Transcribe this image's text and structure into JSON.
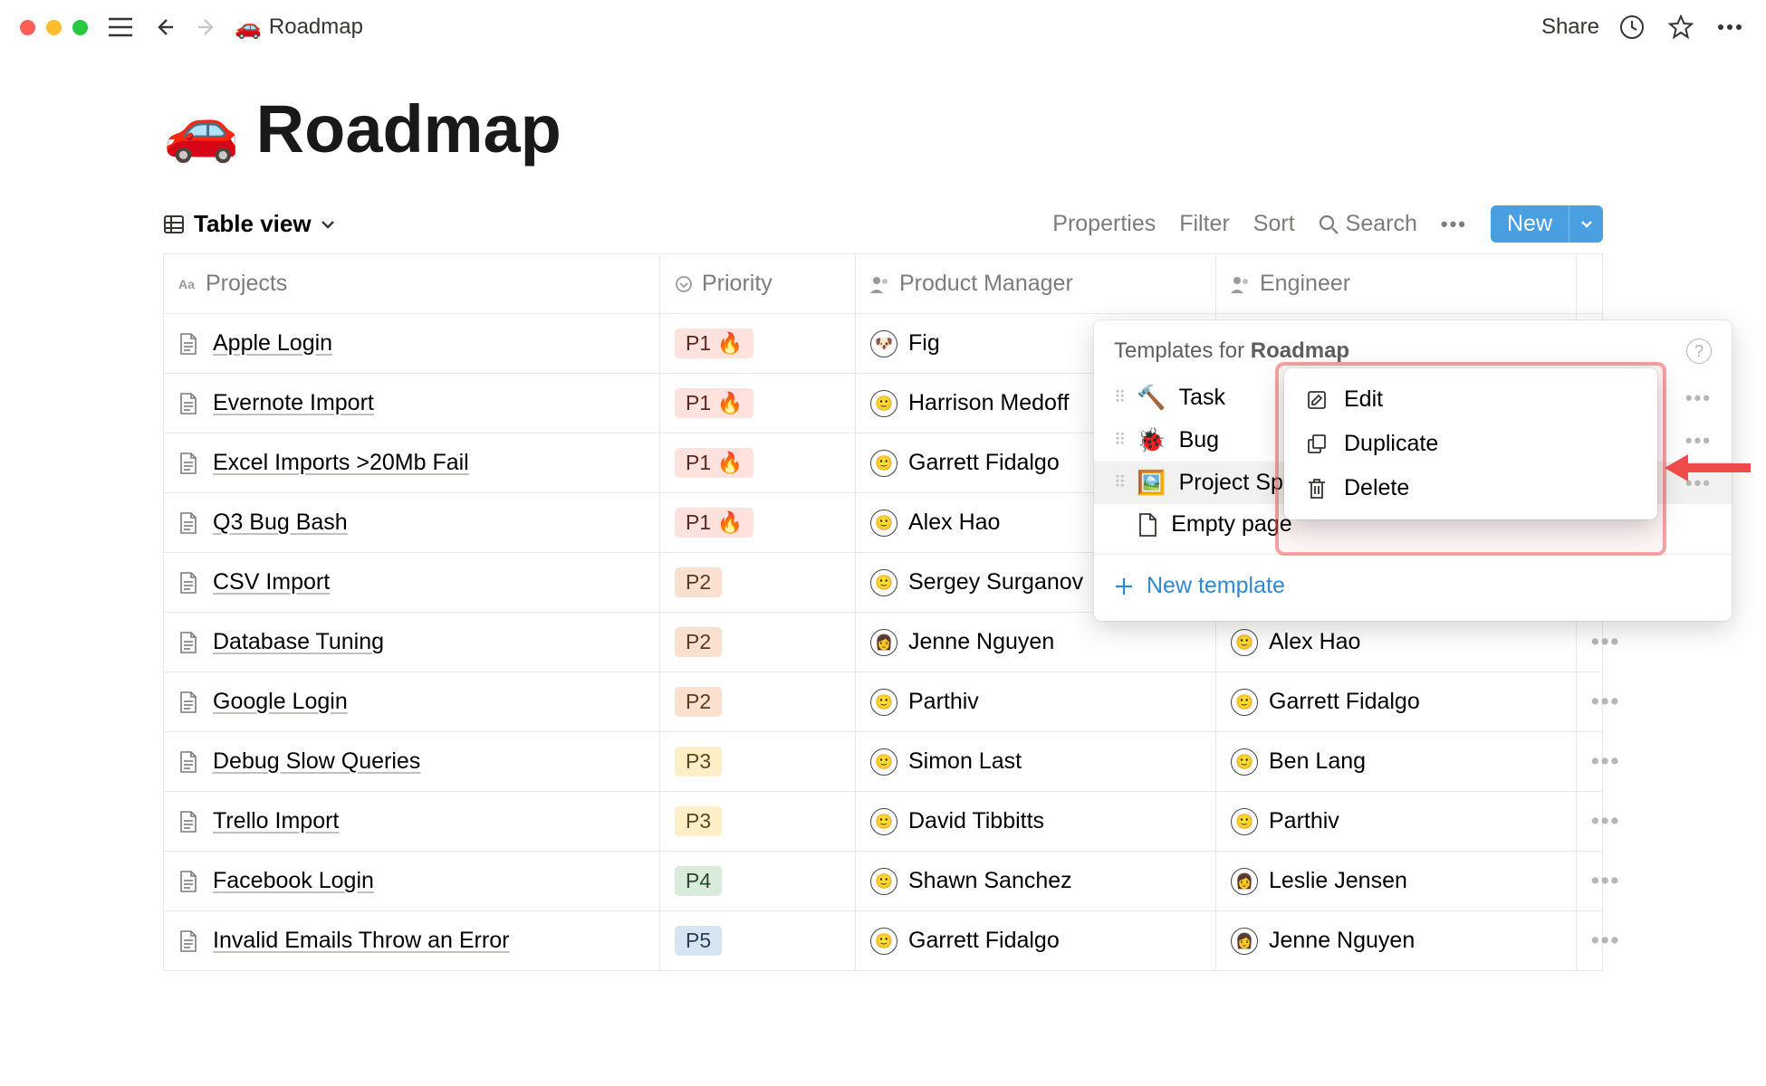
{
  "titlebar": {
    "breadcrumb_emoji": "🚗",
    "breadcrumb_title": "Roadmap",
    "share": "Share"
  },
  "page": {
    "emoji": "🚗",
    "title": "Roadmap"
  },
  "db_toolbar": {
    "view_label": "Table view",
    "properties": "Properties",
    "filter": "Filter",
    "sort": "Sort",
    "search": "Search",
    "new": "New"
  },
  "columns": {
    "projects": "Projects",
    "priority": "Priority",
    "pm": "Product Manager",
    "engineer": "Engineer"
  },
  "rows": [
    {
      "name": "Apple Login",
      "priority": "P1 🔥",
      "p_class": "b-red",
      "pm": "Fig",
      "pm_av": "🐶",
      "eng": "",
      "eng_av": ""
    },
    {
      "name": "Evernote Import",
      "priority": "P1 🔥",
      "p_class": "b-red",
      "pm": "Harrison Medoff",
      "pm_av": "🙂",
      "eng": "",
      "eng_av": ""
    },
    {
      "name": "Excel Imports >20Mb Fail",
      "priority": "P1 🔥",
      "p_class": "b-red",
      "pm": "Garrett Fidalgo",
      "pm_av": "🙂",
      "eng": "",
      "eng_av": ""
    },
    {
      "name": "Q3 Bug Bash",
      "priority": "P1 🔥",
      "p_class": "b-red",
      "pm": "Alex Hao",
      "pm_av": "🙂",
      "eng": "",
      "eng_av": ""
    },
    {
      "name": "CSV Import",
      "priority": "P2",
      "p_class": "b-orange",
      "pm": "Sergey Surganov",
      "pm_av": "🙂",
      "eng": "",
      "eng_av": ""
    },
    {
      "name": "Database Tuning",
      "priority": "P2",
      "p_class": "b-orange",
      "pm": "Jenne Nguyen",
      "pm_av": "👩",
      "eng": "Alex Hao",
      "eng_av": "🙂"
    },
    {
      "name": "Google Login",
      "priority": "P2",
      "p_class": "b-orange",
      "pm": "Parthiv",
      "pm_av": "🙂",
      "eng": "Garrett Fidalgo",
      "eng_av": "🙂"
    },
    {
      "name": "Debug Slow Queries",
      "priority": "P3",
      "p_class": "b-yellow",
      "pm": "Simon Last",
      "pm_av": "🙂",
      "eng": "Ben Lang",
      "eng_av": "🙂"
    },
    {
      "name": "Trello Import",
      "priority": "P3",
      "p_class": "b-yellow",
      "pm": "David Tibbitts",
      "pm_av": "🙂",
      "eng": "Parthiv",
      "eng_av": "🙂"
    },
    {
      "name": "Facebook Login",
      "priority": "P4",
      "p_class": "b-green",
      "pm": "Shawn Sanchez",
      "pm_av": "🙂",
      "eng": "Leslie Jensen",
      "eng_av": "👩"
    },
    {
      "name": "Invalid Emails Throw an Error",
      "priority": "P5",
      "p_class": "b-blue",
      "pm": "Garrett Fidalgo",
      "pm_av": "🙂",
      "eng": "Jenne Nguyen",
      "eng_av": "👩"
    }
  ],
  "popup": {
    "title_prefix": "Templates for ",
    "title_bold": "Roadmap",
    "items": [
      {
        "emoji": "🔨",
        "label": "Task"
      },
      {
        "emoji": "🐞",
        "label": "Bug"
      },
      {
        "emoji": "🖼️",
        "label": "Project Spec"
      }
    ],
    "empty": "Empty page",
    "new_template": "New template"
  },
  "ctx": {
    "edit": "Edit",
    "duplicate": "Duplicate",
    "delete": "Delete"
  }
}
